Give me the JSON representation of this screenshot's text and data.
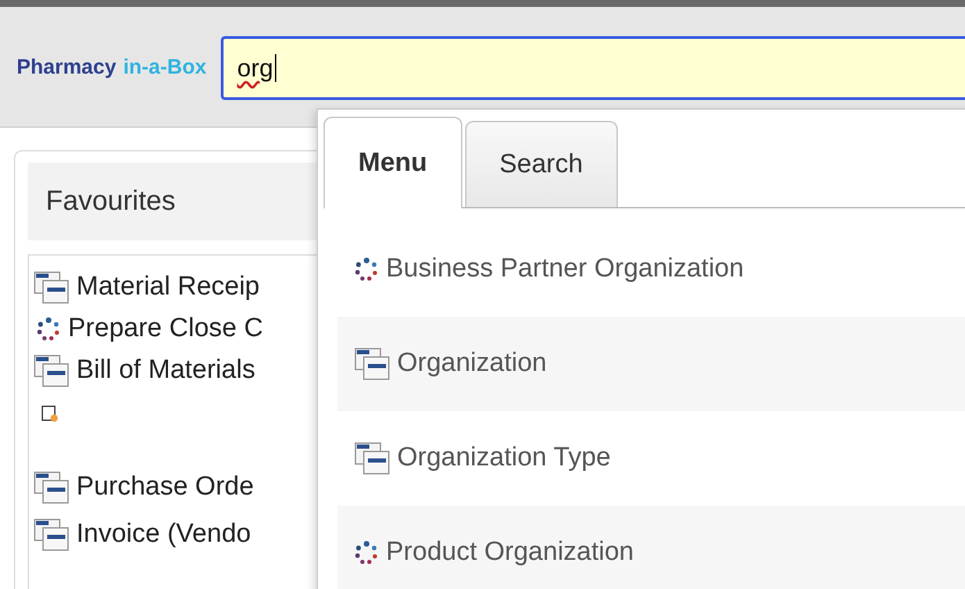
{
  "header": {
    "brand": [
      {
        "text": "Pharmacy",
        "kind": "primary"
      },
      {
        "text": "in-a-Box",
        "kind": "accent"
      }
    ],
    "search": {
      "value": "org"
    }
  },
  "favourites": {
    "title": "Favourites",
    "items": [
      {
        "kind": "window",
        "label": "Material Receip"
      },
      {
        "kind": "process",
        "label": "Prepare Close C"
      },
      {
        "kind": "window",
        "label": "Bill of Materials"
      },
      {
        "kind": "report"
      },
      {
        "kind": "window",
        "label": "Purchase Orde"
      },
      {
        "kind": "window",
        "label": "Invoice (Vendo"
      }
    ]
  },
  "popup": {
    "tabs": [
      {
        "label": "Menu",
        "selected": true
      },
      {
        "label": "Search",
        "selected": false
      }
    ],
    "results": [
      {
        "kind": "process",
        "label": "Business Partner Organization"
      },
      {
        "kind": "window",
        "label": "Organization"
      },
      {
        "kind": "window",
        "label": "Organization Type"
      },
      {
        "kind": "process",
        "label": "Product Organization"
      }
    ]
  }
}
